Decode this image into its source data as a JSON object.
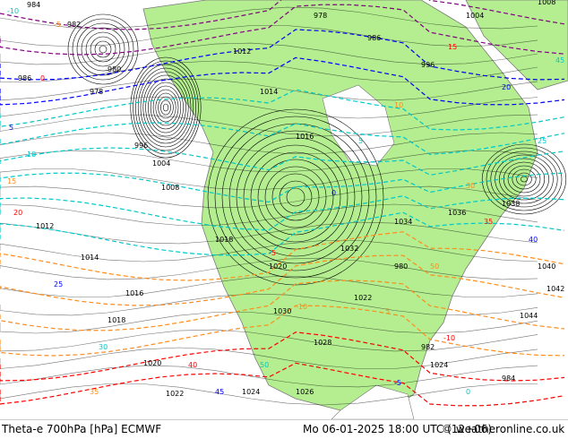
{
  "footer": {
    "title": "Theta-e 700hPa [hPa] ECMWF",
    "valid_time": "Mo 06-01-2025 18:00 UTC (12+06)",
    "site": "© weatheronline.co.uk"
  },
  "colors": {
    "land": "#b4ee90",
    "ocean": "#ffffff",
    "isobar": "#000000",
    "cold_theta": "#00c8c8",
    "warm_theta": "#ff8c1a",
    "hot_theta": "#ff0000",
    "very_cold_theta": "#0000ff",
    "coldest_theta": "#800080"
  },
  "pressure_labels": [
    "984",
    "982",
    "980",
    "978",
    "986",
    "996",
    "1004",
    "1008",
    "1012",
    "1014",
    "1016",
    "1018",
    "1020",
    "1022",
    "1024",
    "1026",
    "1028",
    "1030",
    "1032",
    "1034",
    "1036",
    "1038",
    "1040",
    "1042",
    "1044"
  ],
  "theta_labels": [
    "-10",
    "-5",
    "0",
    "5",
    "10",
    "15",
    "20",
    "25",
    "30",
    "35",
    "40",
    "45",
    "50"
  ]
}
